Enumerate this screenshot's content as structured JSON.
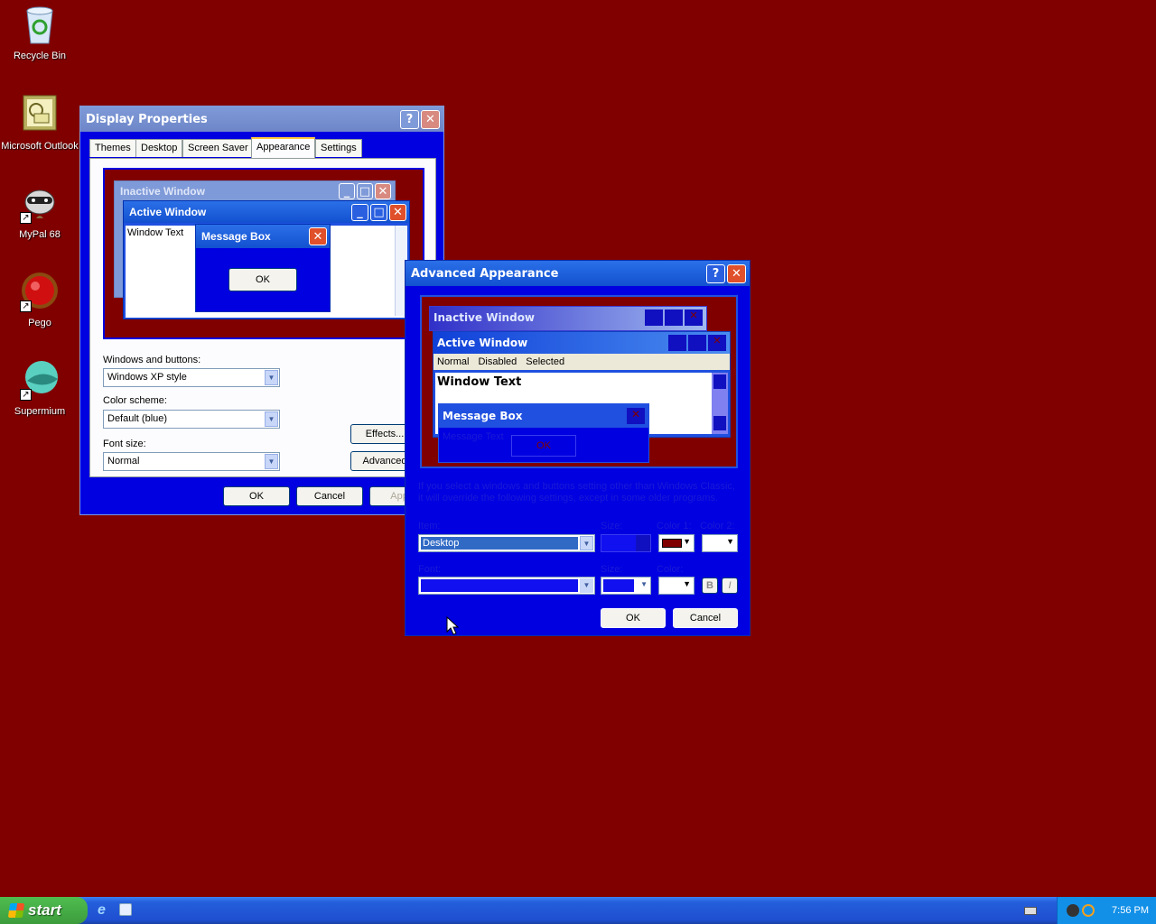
{
  "desktop": {
    "icons": [
      {
        "label": "Recycle Bin",
        "icon": "recycle-bin-icon"
      },
      {
        "label": "Microsoft Outlook",
        "icon": "outlook-icon"
      },
      {
        "label": "MyPal 68",
        "icon": "mypal-raccoon-icon"
      },
      {
        "label": "Pego",
        "icon": "pego-icon"
      },
      {
        "label": "Supermium",
        "icon": "supermium-icon"
      }
    ],
    "background_color": "#800000"
  },
  "display_properties": {
    "title": "Display Properties",
    "tabs": [
      "Themes",
      "Desktop",
      "Screen Saver",
      "Appearance",
      "Settings"
    ],
    "active_tab": "Appearance",
    "preview": {
      "inactive_window": "Inactive Window",
      "active_window": "Active Window",
      "window_text": "Window Text",
      "message_box": "Message Box",
      "ok": "OK"
    },
    "windows_and_buttons_label": "Windows and buttons:",
    "windows_and_buttons_value": "Windows XP style",
    "color_scheme_label": "Color scheme:",
    "color_scheme_value": "Default (blue)",
    "font_size_label": "Font size:",
    "font_size_value": "Normal",
    "effects_button": "Effects...",
    "advanced_button": "Advanced",
    "ok": "OK",
    "cancel": "Cancel",
    "apply": "Apply"
  },
  "advanced_appearance": {
    "title": "Advanced Appearance",
    "preview": {
      "inactive_window": "Inactive Window",
      "active_window": "Active Window",
      "menu_normal": "Normal",
      "menu_disabled": "Disabled",
      "menu_selected": "Selected",
      "window_text": "Window Text",
      "message_box": "Message Box",
      "message_text": "Message Text",
      "ok": "OK"
    },
    "info_text_line1": "If you select a windows and buttons setting other than Windows Classic,",
    "info_text_line2": "it will override the following settings, except in some older programs.",
    "item_label": "Item:",
    "item_value": "Desktop",
    "size_label": "Size:",
    "color1_label": "Color 1:",
    "color2_label": "Color 2:",
    "color1_value": "#800000",
    "font_label": "Font:",
    "font_size_label": "Size:",
    "font_color_label": "Color:",
    "bold": "B",
    "italic": "I",
    "ok": "OK",
    "cancel": "Cancel"
  },
  "taskbar": {
    "start": "start",
    "clock": "7:56 PM"
  }
}
